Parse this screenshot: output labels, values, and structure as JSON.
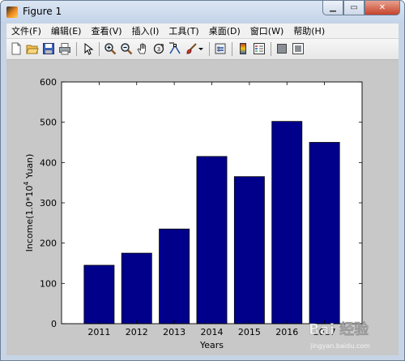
{
  "window": {
    "title": "Figure 1"
  },
  "menu": [
    "文件(F)",
    "编辑(E)",
    "查看(V)",
    "插入(I)",
    "工具(T)",
    "桌面(D)",
    "窗口(W)",
    "帮助(H)"
  ],
  "toolbar_icons": [
    "new-figure-icon",
    "open-file-icon",
    "save-icon",
    "print-icon",
    "arrow-pointer-icon",
    "zoom-in-icon",
    "zoom-out-icon",
    "pan-hand-icon",
    "rotate-3d-icon",
    "data-cursor-icon",
    "brush-icon",
    "brush-dropdown-icon",
    "link-plot-icon",
    "colorbar-icon",
    "legend-icon",
    "hide-plot-tools-icon",
    "show-plot-tools-icon"
  ],
  "chart_data": {
    "type": "bar",
    "categories": [
      "2011",
      "2012",
      "2013",
      "2014",
      "2015",
      "2016",
      "2017"
    ],
    "values": [
      145,
      175,
      235,
      415,
      365,
      502,
      450
    ],
    "ylim": [
      0,
      600
    ],
    "yticks": [
      0,
      100,
      200,
      300,
      400,
      500,
      600
    ],
    "xlabel": "Years",
    "ylabel_prefix": "Income(1.0*10",
    "ylabel_exp": "4",
    "ylabel_suffix": " Yuan)",
    "bar_color": "#00008b",
    "grid": false
  },
  "watermark": {
    "text": "Bai 经验",
    "sub": "jingyan.baidu.com"
  }
}
